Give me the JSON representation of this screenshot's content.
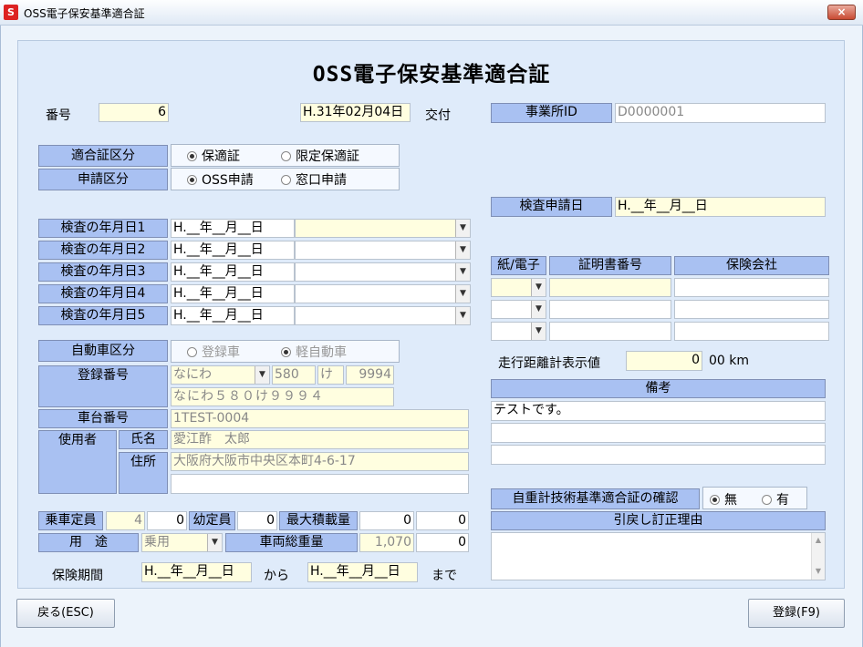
{
  "window": {
    "title": "OSS電子保安基準適合証",
    "close_glyph": "×"
  },
  "form": {
    "heading": "OSS電子保安基準適合証"
  },
  "number": {
    "label": "番号",
    "value": "6"
  },
  "issue": {
    "date": "H.31年02月04日",
    "label": "交付"
  },
  "office": {
    "label": "事業所ID",
    "value": "D0000001"
  },
  "cert_type": {
    "label": "適合証区分",
    "options": [
      "保適証",
      "限定保適証"
    ]
  },
  "application_type": {
    "label": "申請区分",
    "options": [
      "OSS申請",
      "窓口申請"
    ]
  },
  "inspection_request": {
    "label": "検査申請日",
    "value": "H.__年__月__日"
  },
  "inspection_dates": [
    {
      "label": "検査の年月日1",
      "value": "H.__年__月__日"
    },
    {
      "label": "検査の年月日2",
      "value": "H.__年__月__日"
    },
    {
      "label": "検査の年月日3",
      "value": "H.__年__月__日"
    },
    {
      "label": "検査の年月日4",
      "value": "H.__年__月__日"
    },
    {
      "label": "検査の年月日5",
      "value": "H.__年__月__日"
    }
  ],
  "insurance_table": {
    "headers": [
      "紙/電子",
      "証明書番号",
      "保険会社"
    ]
  },
  "odometer": {
    "label": "走行距離計表示値",
    "value": "0",
    "unit": "00 km"
  },
  "vehicle_class": {
    "label": "自動車区分",
    "options": [
      "登録車",
      "軽自動車"
    ]
  },
  "registration": {
    "label": "登録番号",
    "region": "なにわ",
    "class_no": "580",
    "kana": "け",
    "serial": "9994",
    "full": "なにわ５８０け９９９４"
  },
  "chassis": {
    "label": "車台番号",
    "value": "1TEST-0004"
  },
  "user": {
    "label": "使用者",
    "name_label": "氏名",
    "name": "愛江酢　太郎",
    "address_label": "住所",
    "address": "大阪府大阪市中央区本町4-6-17"
  },
  "remarks": {
    "label": "備考",
    "value": "テストです。"
  },
  "weight_confirm": {
    "label": "自重計技術基準適合証の確認",
    "options": [
      "無",
      "有"
    ]
  },
  "correction": {
    "label": "引戻し訂正理由"
  },
  "capacity": {
    "label": "乗車定員",
    "value1": "4",
    "value2": "0",
    "label2": "幼定員",
    "value3": "0",
    "max_load_label": "最大積載量",
    "max_load1": "0",
    "max_load2": "0"
  },
  "usage": {
    "label": "用　途",
    "value": "乗用",
    "gross_label": "車両総重量",
    "gross1": "1,070",
    "gross2": "0"
  },
  "insurance_period": {
    "label": "保険期間",
    "from": "H.__年__月__日",
    "from_label": "から",
    "to": "H.__年__月__日",
    "to_label": "まで"
  },
  "buttons": {
    "back": "戻る(ESC)",
    "register": "登録(F9)"
  }
}
